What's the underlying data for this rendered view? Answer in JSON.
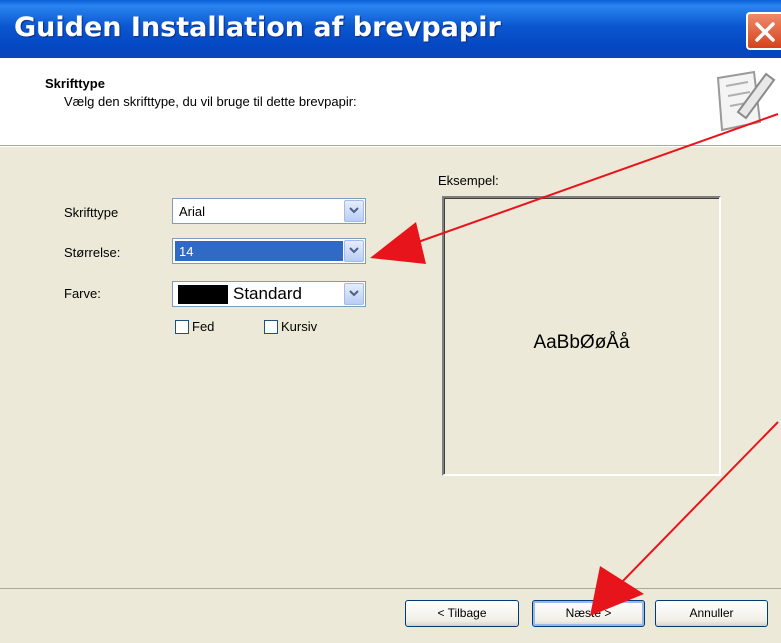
{
  "window": {
    "title": "Guiden Installation af brevpapir",
    "close_icon": "close-icon"
  },
  "header": {
    "title": "Skrifttype",
    "subtitle": "Vælg den skrifttype, du vil bruge til dette brevpapir:",
    "icon": "stationery-wizard-icon"
  },
  "form": {
    "font_label": "Skrifttype",
    "font_value": "Arial",
    "size_label": "Størrelse:",
    "size_value": "14",
    "color_label": "Farve:",
    "color_value": "Standard",
    "color_swatch": "#000000",
    "bold_label": "Fed",
    "bold_checked": false,
    "italic_label": "Kursiv",
    "italic_checked": false
  },
  "preview": {
    "label": "Eksempel:",
    "sample_text": "AaBbØøÅå"
  },
  "buttons": {
    "back": "< Tilbage",
    "next": "Næste >",
    "cancel": "Annuller"
  },
  "annotation": {
    "arrow_color": "#e8141c"
  }
}
